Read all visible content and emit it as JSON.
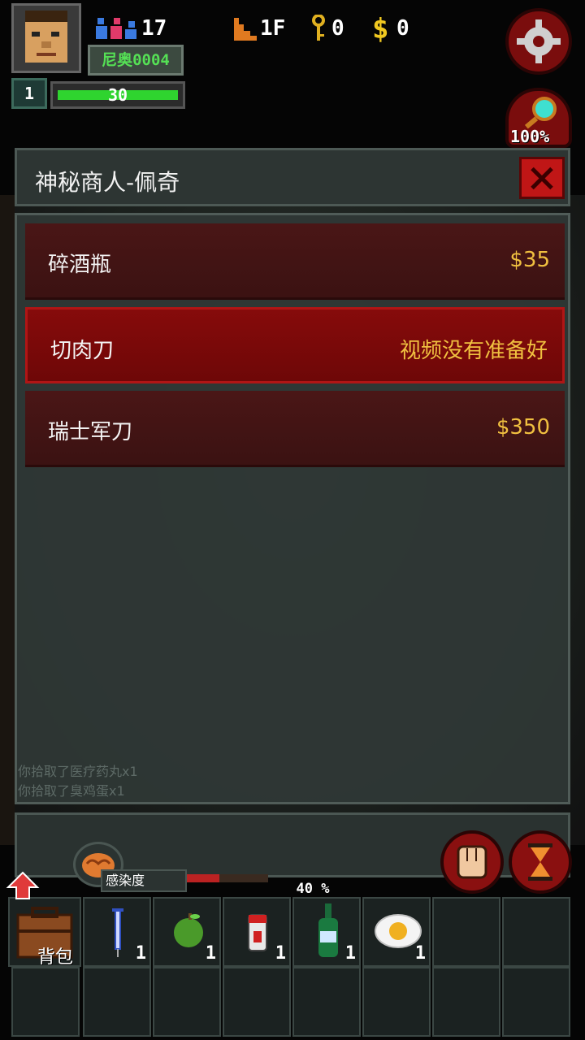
{
  "hud": {
    "player_name": "尼奥0004",
    "party_count": "17",
    "level": "1",
    "hp": "30",
    "hp_fraction": 1.0,
    "floor": "1F",
    "keys": "0",
    "money": "0",
    "zoom": "100%"
  },
  "dialog": {
    "title": "神秘商人-佩奇",
    "items": [
      {
        "name": "碎酒瓶",
        "price": "$35",
        "selected": false
      },
      {
        "name": "切肉刀",
        "price": "视频没有准备好",
        "selected": true
      },
      {
        "name": "瑞士军刀",
        "price": "$350",
        "selected": false
      }
    ]
  },
  "messages": [
    "你拾取了医疗药丸x1",
    "你拾取了臭鸡蛋x1"
  ],
  "status": {
    "infection_label": "感染度",
    "infection_pct": "40 %",
    "infection_fraction": 0.4
  },
  "inventory": {
    "bag_label": "背包",
    "slots": [
      {
        "icon": "syringe-icon",
        "qty": "1"
      },
      {
        "icon": "green-apple-icon",
        "qty": "1"
      },
      {
        "icon": "pill-bottle-icon",
        "qty": "1"
      },
      {
        "icon": "green-bottle-icon",
        "qty": "1"
      },
      {
        "icon": "fried-egg-icon",
        "qty": "1"
      }
    ]
  }
}
